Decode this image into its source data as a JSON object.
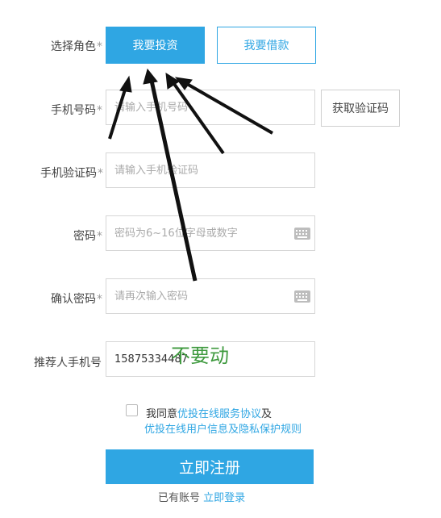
{
  "role": {
    "label": "选择角色",
    "invest_label": "我要投资",
    "borrow_label": "我要借款"
  },
  "phone": {
    "label": "手机号码",
    "placeholder": "请输入手机号码",
    "code_button": "获取验证码"
  },
  "sms": {
    "label": "手机验证码",
    "placeholder": "请输入手机验证码"
  },
  "password": {
    "label": "密码",
    "placeholder": "密码为6~16位字母或数字",
    "keyboard_icon": "keyboard-icon"
  },
  "confirm": {
    "label": "确认密码",
    "placeholder": "请再次输入密码",
    "keyboard_icon": "keyboard-icon"
  },
  "referrer": {
    "label": "推荐人手机号",
    "value": "15875334487"
  },
  "required_mark": "*",
  "annotation": {
    "text": "不要动"
  },
  "agreement": {
    "prefix": "我同意",
    "link1": "优投在线服务协议",
    "conj": "及",
    "link2": "优投在线用户信息及隐私保护规则"
  },
  "submit_label": "立即注册",
  "login": {
    "prefix": "已有账号",
    "link": "立即登录"
  },
  "colors": {
    "accent": "#2fa6e3",
    "annotation": "#3f9a3f"
  }
}
